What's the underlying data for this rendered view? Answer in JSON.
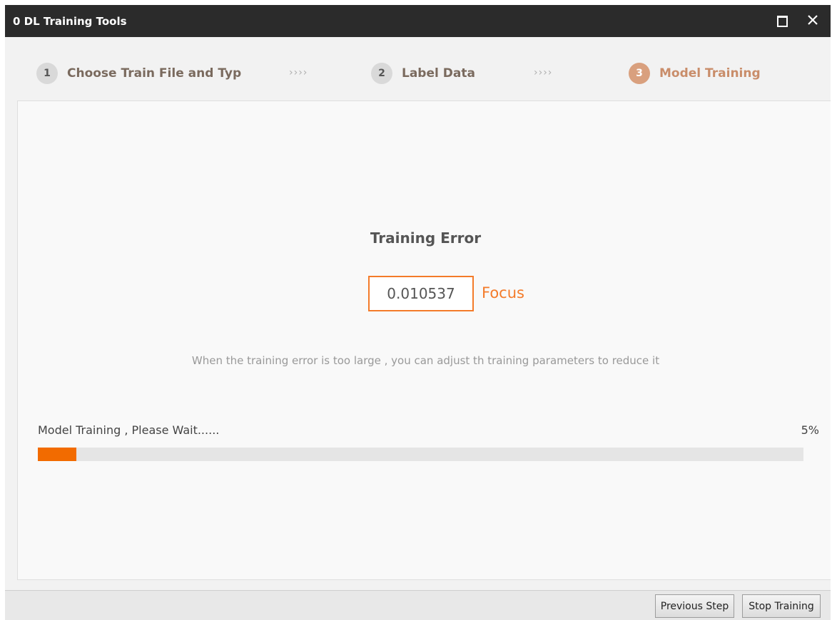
{
  "window": {
    "title": "0 DL Training Tools"
  },
  "titlebar_icons": {
    "maximize": "maximize-icon",
    "close": "close-icon"
  },
  "steps": [
    {
      "number": "1",
      "label": "Choose Train File and Typ",
      "active": false
    },
    {
      "number": "2",
      "label": "Label Data",
      "active": false
    },
    {
      "number": "3",
      "label": "Model Training",
      "active": true
    }
  ],
  "step_separator": "››››",
  "main": {
    "error_title": "Training Error",
    "error_value": "0.010537",
    "focus_label": "Focus",
    "hint": "When the training error is too large , you can adjust th training parameters to reduce it",
    "progress_label": "Model Training ,  Please Wait......",
    "progress_percent_text": "5%",
    "progress_value": 0.05
  },
  "buttons": {
    "previous": "Previous Step",
    "stop": "Stop Training"
  },
  "colors": {
    "accent": "#f47b2a",
    "progress_fill": "#f26b00",
    "active_step": "#d9a07e",
    "titlebar": "#2b2b2b"
  }
}
